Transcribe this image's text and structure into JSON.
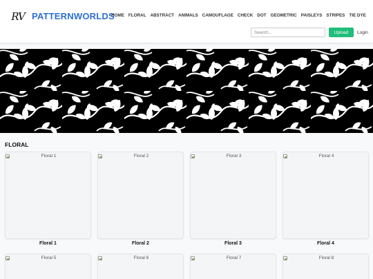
{
  "header": {
    "logo_text": "RV",
    "brand": "PATTERNWORLDS",
    "nav": [
      "HOME",
      "FLORAL",
      "ABSTRACT",
      "ANIMALS",
      "CAMOUFLAGE",
      "CHECK",
      "DOT",
      "GEOMETRIC",
      "PAISLEYS",
      "STRIPES",
      "TIE DYE"
    ],
    "search_placeholder": "Search...",
    "upload_label": "Upload",
    "login_label": "Login"
  },
  "hero": {
    "pattern": "floral-vine-black-white"
  },
  "section": {
    "title": "FLORAL"
  },
  "cards": [
    {
      "alt": "Floral 1",
      "label": "Floral 1"
    },
    {
      "alt": "Floral 2",
      "label": "Floral 2"
    },
    {
      "alt": "Floral 3",
      "label": "Floral 3"
    },
    {
      "alt": "Floral 4",
      "label": "Floral 4"
    },
    {
      "alt": "Floral 5",
      "label": ""
    },
    {
      "alt": "Floral 6",
      "label": ""
    },
    {
      "alt": "Floral 7",
      "label": ""
    },
    {
      "alt": "Floral 8",
      "label": ""
    }
  ],
  "colors": {
    "brand": "#2d6fd3",
    "upload": "#1fbe7a",
    "hero_bg": "#000000"
  }
}
